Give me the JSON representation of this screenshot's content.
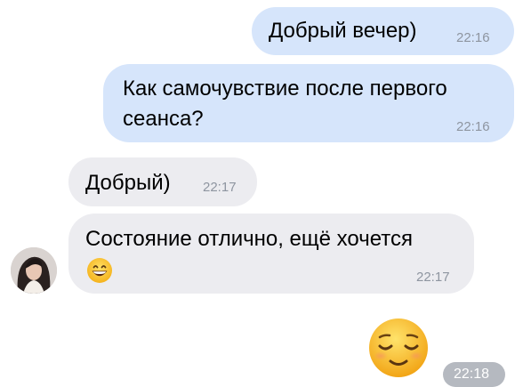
{
  "messages": [
    {
      "text": "Добрый вечер)",
      "time": "22:16"
    },
    {
      "text": "Как самочувствие после первого сеанса?",
      "line1": "Как самочувствие после первого",
      "line2": "сеанса?",
      "time": "22:16"
    },
    {
      "text": "Добрый)",
      "time": "22:17"
    },
    {
      "text": "Состояние отлично, ещё хочется 😄",
      "line1": "Состояние отлично, ещё хочется",
      "emoji": "grinning-face-emoji",
      "time": "22:17"
    },
    {
      "emoji": "relieved-face-emoji",
      "time": "22:18"
    }
  ],
  "colors": {
    "outgoing_bubble": "#d6e5fb",
    "incoming_bubble": "#ececf0",
    "time_text": "#8e95a0",
    "time_pill": "#b5b9c0",
    "emoji_face": "#f9c52c"
  },
  "avatar": {
    "icon": "contact-avatar"
  }
}
